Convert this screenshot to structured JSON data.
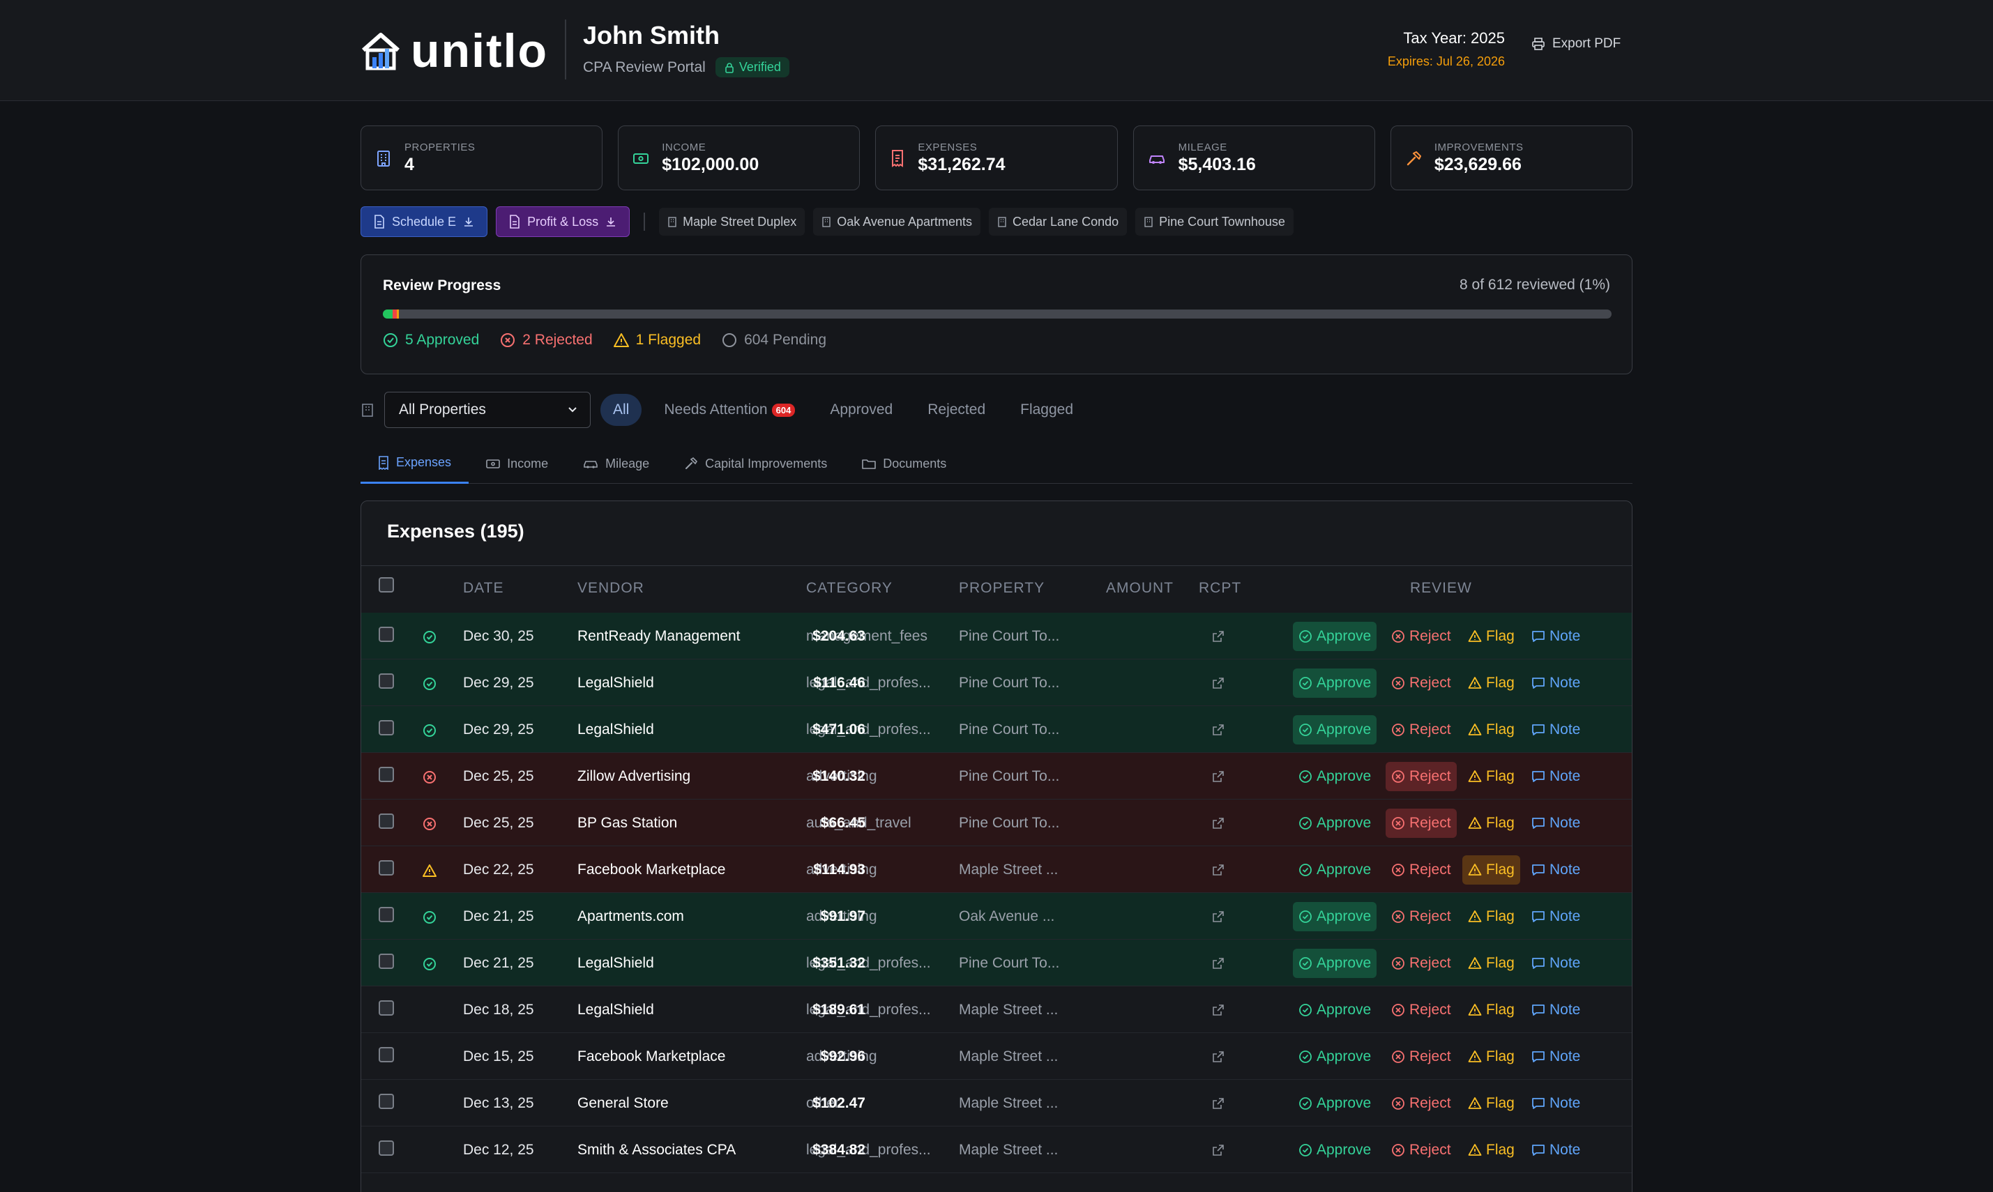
{
  "header": {
    "brand": "unitlo",
    "client_name": "John Smith",
    "portal_label": "CPA Review Portal",
    "verified_label": "Verified",
    "tax_year": "Tax Year: 2025",
    "expires": "Expires: Jul 26, 2026",
    "export_label": "Export PDF"
  },
  "stats": [
    {
      "label": "PROPERTIES",
      "value": "4",
      "icon": "building-icon",
      "color": "#7da4ff"
    },
    {
      "label": "INCOME",
      "value": "$102,000.00",
      "icon": "cash-icon",
      "color": "#34d399"
    },
    {
      "label": "EXPENSES",
      "value": "$31,262.74",
      "icon": "receipt-icon",
      "color": "#f87171"
    },
    {
      "label": "MILEAGE",
      "value": "$5,403.16",
      "icon": "car-icon",
      "color": "#c084fc"
    },
    {
      "label": "IMPROVEMENTS",
      "value": "$23,629.66",
      "icon": "hammer-icon",
      "color": "#fb923c"
    }
  ],
  "reports": {
    "schedule_e": "Schedule E",
    "profit_loss": "Profit & Loss"
  },
  "properties": [
    "Maple Street Duplex",
    "Oak Avenue Apartments",
    "Cedar Lane Condo",
    "Pine Court Townhouse"
  ],
  "progress": {
    "title": "Review Progress",
    "count_text": "8 of 612 reviewed (1%)",
    "approved": 5,
    "rejected": 2,
    "flagged": 1,
    "total": 612,
    "approved_label": "5 Approved",
    "rejected_label": "2 Rejected",
    "flagged_label": "1 Flagged",
    "pending_label": "604 Pending"
  },
  "filters": {
    "property_select": "All Properties",
    "pills": [
      "All",
      "Needs Attention",
      "Approved",
      "Rejected",
      "Flagged"
    ],
    "needs_attention_count": "604"
  },
  "tabs": [
    "Expenses",
    "Income",
    "Mileage",
    "Capital Improvements",
    "Documents"
  ],
  "table": {
    "title": "Expenses (195)",
    "columns": [
      "DATE",
      "VENDOR",
      "CATEGORY",
      "PROPERTY",
      "AMOUNT",
      "RCPT",
      "REVIEW"
    ],
    "actions": {
      "approve": "Approve",
      "reject": "Reject",
      "flag": "Flag",
      "note": "Note"
    },
    "rows": [
      {
        "status": "approved",
        "date": "Dec 30, 25",
        "vendor": "RentReady Management",
        "category": "management_fees",
        "property": "Pine Court To...",
        "amount": "$204.63"
      },
      {
        "status": "approved",
        "date": "Dec 29, 25",
        "vendor": "LegalShield",
        "category": "legal_and_profes...",
        "property": "Pine Court To...",
        "amount": "$116.46"
      },
      {
        "status": "approved",
        "date": "Dec 29, 25",
        "vendor": "LegalShield",
        "category": "legal_and_profes...",
        "property": "Pine Court To...",
        "amount": "$471.06"
      },
      {
        "status": "rejected",
        "date": "Dec 25, 25",
        "vendor": "Zillow Advertising",
        "category": "advertising",
        "property": "Pine Court To...",
        "amount": "$140.32"
      },
      {
        "status": "rejected",
        "date": "Dec 25, 25",
        "vendor": "BP Gas Station",
        "category": "auto_and_travel",
        "property": "Pine Court To...",
        "amount": "$66.45"
      },
      {
        "status": "flagged",
        "date": "Dec 22, 25",
        "vendor": "Facebook Marketplace",
        "category": "advertising",
        "property": "Maple Street ...",
        "amount": "$114.93"
      },
      {
        "status": "approved",
        "date": "Dec 21, 25",
        "vendor": "Apartments.com",
        "category": "advertising",
        "property": "Oak Avenue ...",
        "amount": "$91.97"
      },
      {
        "status": "approved",
        "date": "Dec 21, 25",
        "vendor": "LegalShield",
        "category": "legal_and_profes...",
        "property": "Pine Court To...",
        "amount": "$351.32"
      },
      {
        "status": "pending",
        "date": "Dec 18, 25",
        "vendor": "LegalShield",
        "category": "legal_and_profes...",
        "property": "Maple Street ...",
        "amount": "$189.61"
      },
      {
        "status": "pending",
        "date": "Dec 15, 25",
        "vendor": "Facebook Marketplace",
        "category": "advertising",
        "property": "Maple Street ...",
        "amount": "$92.96"
      },
      {
        "status": "pending",
        "date": "Dec 13, 25",
        "vendor": "General Store",
        "category": "other",
        "property": "Maple Street ...",
        "amount": "$102.47"
      },
      {
        "status": "pending",
        "date": "Dec 12, 25",
        "vendor": "Smith & Associates CPA",
        "category": "legal_and_profes...",
        "property": "Maple Street ...",
        "amount": "$384.82"
      }
    ]
  }
}
